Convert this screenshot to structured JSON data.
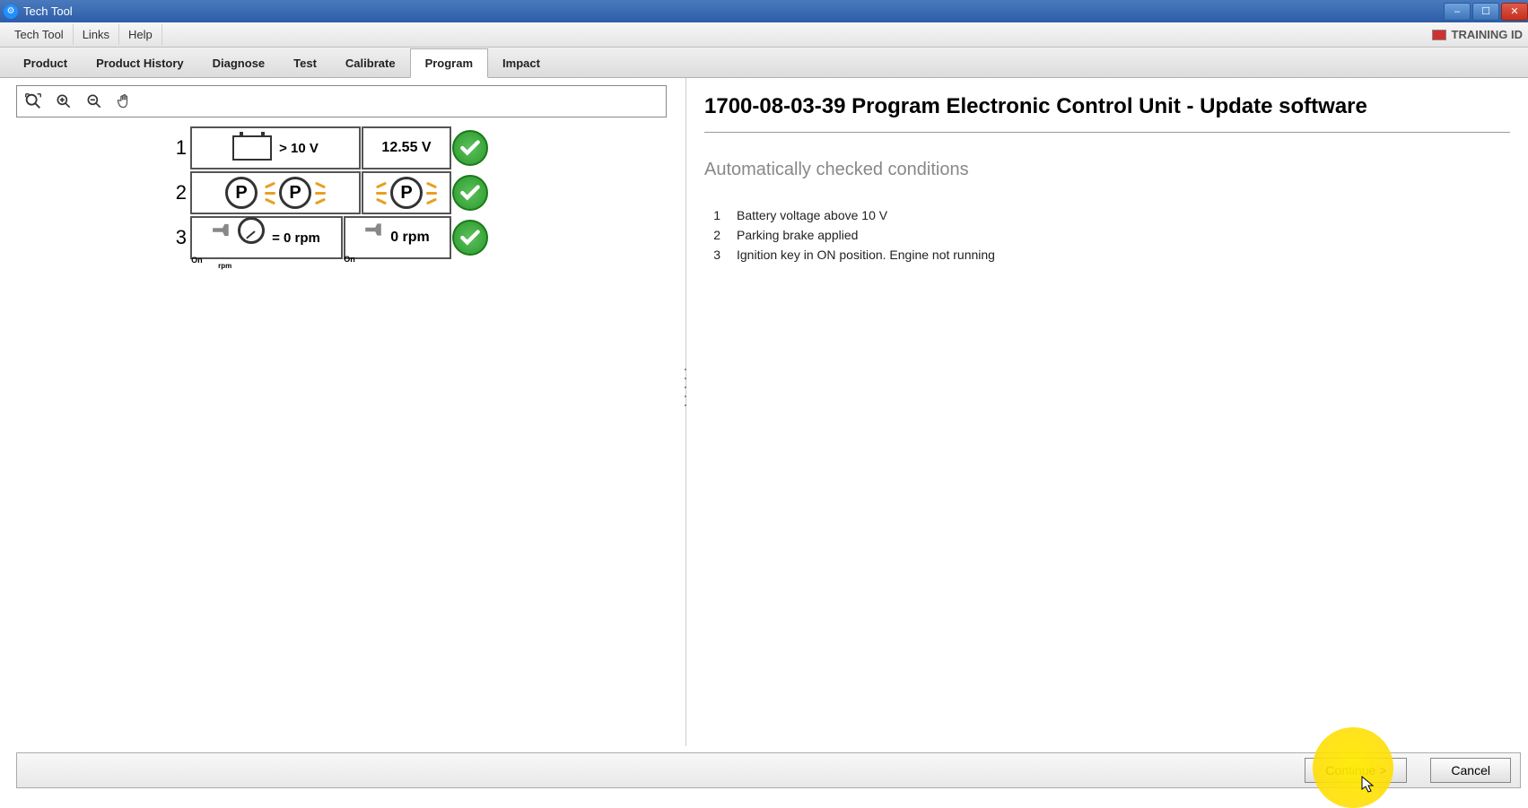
{
  "window": {
    "title": "Tech Tool"
  },
  "menu": {
    "items": [
      "Tech Tool",
      "Links",
      "Help"
    ],
    "training": "TRAINING ID"
  },
  "tabs": {
    "items": [
      "Product",
      "Product History",
      "Diagnose",
      "Test",
      "Calibrate",
      "Program",
      "Impact"
    ],
    "active": "Program"
  },
  "conditions_diagram": {
    "rows": [
      {
        "num": "1",
        "req_text": "> 10 V",
        "val_text": "12.55 V"
      },
      {
        "num": "2",
        "req_text": "",
        "val_text": ""
      },
      {
        "num": "3",
        "req_text": "= 0 rpm",
        "val_text": "0 rpm"
      }
    ],
    "on_label": "On",
    "rpm_label": "rpm"
  },
  "right": {
    "title": "1700-08-03-39 Program Electronic Control Unit - Update software",
    "subtitle": "Automatically checked conditions",
    "items": [
      {
        "num": "1",
        "text": "Battery voltage above 10 V"
      },
      {
        "num": "2",
        "text": "Parking brake applied"
      },
      {
        "num": "3",
        "text": "Ignition key in ON position. Engine not running"
      }
    ]
  },
  "footer": {
    "continue": "Continue >",
    "cancel": "Cancel"
  }
}
